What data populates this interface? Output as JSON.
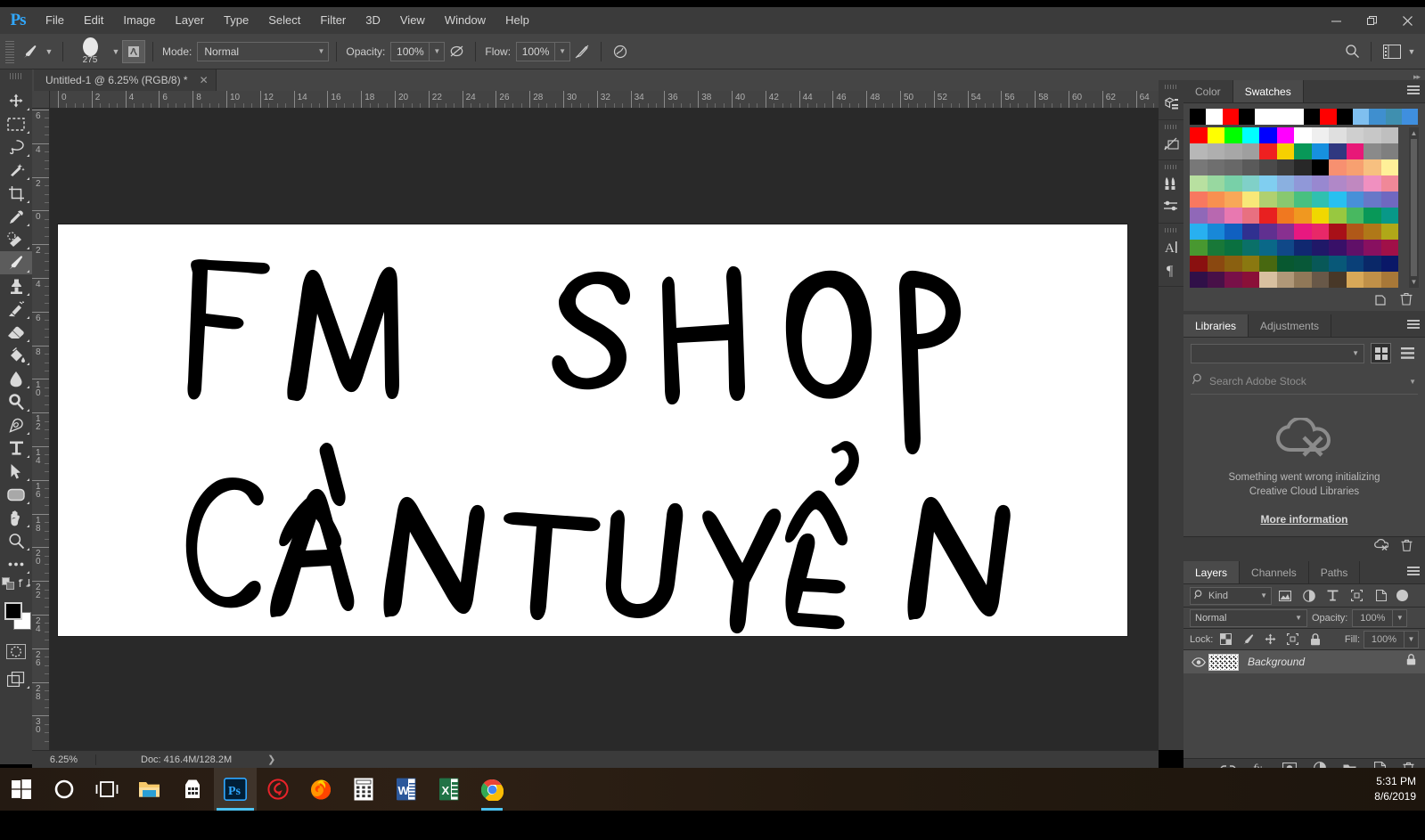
{
  "app": {
    "logo": "Ps",
    "title": "Adobe Photoshop"
  },
  "menubar": {
    "items": [
      "File",
      "Edit",
      "Image",
      "Layer",
      "Type",
      "Select",
      "Filter",
      "3D",
      "View",
      "Window",
      "Help"
    ]
  },
  "window_controls": {
    "minimize": "—",
    "restore": "❐",
    "close": "✕"
  },
  "options_bar": {
    "brush_size": "275",
    "mode_label": "Mode:",
    "mode_value": "Normal",
    "opacity_label": "Opacity:",
    "opacity_value": "100%",
    "flow_label": "Flow:",
    "flow_value": "100%",
    "airbrush_title": "Airbrush",
    "smoothing_title": "Smoothing",
    "tablet_pressure_title": "Tablet pressure"
  },
  "document_tab": {
    "title": "Untitled-1 @ 6.25% (RGB/8) *",
    "close": "✕"
  },
  "toolbar": {
    "tools": [
      {
        "name": "move-tool",
        "title": "Move Tool"
      },
      {
        "name": "marquee-tool",
        "title": "Rectangular Marquee Tool"
      },
      {
        "name": "lasso-tool",
        "title": "Lasso Tool"
      },
      {
        "name": "quick-selection-tool",
        "title": "Quick Selection Tool"
      },
      {
        "name": "crop-tool",
        "title": "Crop Tool"
      },
      {
        "name": "eyedropper-tool",
        "title": "Eyedropper Tool"
      },
      {
        "name": "healing-brush-tool",
        "title": "Spot Healing Brush Tool"
      },
      {
        "name": "brush-tool",
        "title": "Brush Tool",
        "active": true
      },
      {
        "name": "clone-stamp-tool",
        "title": "Clone Stamp Tool"
      },
      {
        "name": "history-brush-tool",
        "title": "History Brush Tool"
      },
      {
        "name": "eraser-tool",
        "title": "Eraser Tool"
      },
      {
        "name": "gradient-tool",
        "title": "Paint Bucket Tool"
      },
      {
        "name": "blur-tool",
        "title": "Blur Tool"
      },
      {
        "name": "dodge-tool",
        "title": "Dodge Tool"
      },
      {
        "name": "pen-tool",
        "title": "Pen Tool"
      },
      {
        "name": "type-tool",
        "title": "Horizontal Type Tool"
      },
      {
        "name": "path-selection-tool",
        "title": "Path Selection Tool"
      },
      {
        "name": "rectangle-tool",
        "title": "Rectangle Tool"
      },
      {
        "name": "hand-tool",
        "title": "Hand Tool"
      },
      {
        "name": "zoom-tool",
        "title": "Zoom Tool"
      },
      {
        "name": "edit-toolbar-tool",
        "title": "Edit Toolbar"
      }
    ],
    "foreground_color": "#000000",
    "background_color": "#ffffff"
  },
  "rulers": {
    "unit": "cm",
    "horizontal_ticks": [
      0,
      2,
      4,
      6,
      8,
      10,
      12,
      14,
      16,
      18,
      20,
      22,
      24,
      26,
      28,
      30,
      32,
      34,
      36,
      38,
      40,
      42,
      44,
      46,
      48,
      50,
      52,
      54,
      56,
      58,
      60,
      62,
      64
    ],
    "vertical_ticks": [
      6,
      4,
      2,
      0,
      2,
      4,
      6,
      8,
      10,
      12,
      14,
      16,
      18,
      20,
      22,
      24,
      26,
      28,
      30
    ]
  },
  "canvas": {
    "line1": "FM SHOP",
    "line2": "CẦN TUYỂN",
    "background": "#ffffff",
    "ink": "#000000"
  },
  "status_bar": {
    "zoom": "6.25%",
    "doc": "Doc: 416.4M/128.2M",
    "arrow": "❯"
  },
  "rail": {
    "icons": [
      {
        "name": "3d-panel-icon"
      },
      {
        "name": "measurement-log-icon"
      },
      {
        "name": "brushes-panel-icon"
      },
      {
        "name": "brush-settings-icon"
      },
      {
        "name": "character-panel-icon"
      },
      {
        "name": "paragraph-panel-icon"
      }
    ]
  },
  "swatches_panel": {
    "tabs": [
      {
        "label": "Color",
        "active": false
      },
      {
        "label": "Swatches",
        "active": true
      }
    ],
    "top_row": [
      "#000000",
      "#ffffff",
      "#ff0000",
      "#000000",
      "#ffffff",
      "#ffffff",
      "#ffffff",
      "#000000",
      "#ff0000",
      "#000000",
      "#7fbfef",
      "#3f8fcf",
      "#3f8faf",
      "#3f8fdf"
    ],
    "grid": [
      [
        "#ff0000",
        "#ffff00",
        "#00ff00",
        "#00ffff",
        "#0000ff",
        "#ff00ff",
        "#ffffff",
        "#efefef",
        "#dfdfdf",
        "#cfcfcf",
        "#c7c7c7",
        "#bfbfbf"
      ],
      [
        "#b7b7b7",
        "#afafaf",
        "#a7a7a7",
        "#9f9f9f",
        "#ef2020",
        "#f5d000",
        "#089858",
        "#1790df",
        "#303880",
        "#e81878",
        "#8a8a8a",
        "#7f7f7f"
      ],
      [
        "#787878",
        "#6f6f6f",
        "#686868",
        "#5a5a5a",
        "#4a4a4a",
        "#3c3c3c",
        "#282828",
        "#000000",
        "#f79070",
        "#f7a070",
        "#f7c080",
        "#fff098"
      ],
      [
        "#b8e0a0",
        "#98d8a0",
        "#78d0a8",
        "#80d0c8",
        "#80cef0",
        "#8ab0e0",
        "#9098d8",
        "#9888d0",
        "#b088c8",
        "#c088c0",
        "#f090c0",
        "#f08898"
      ],
      [
        "#f87860",
        "#f89050",
        "#f8a858",
        "#f8e878",
        "#b0d070",
        "#88c870",
        "#48c080",
        "#30c0b0",
        "#28c0f0",
        "#4890d8",
        "#6878c8",
        "#7068c0"
      ],
      [
        "#9068b8",
        "#b868b0",
        "#e878b0",
        "#e87080",
        "#e82020",
        "#f07820",
        "#f09820",
        "#f0d800",
        "#98c840",
        "#48b860",
        "#089858",
        "#089888"
      ],
      [
        "#28b0f0",
        "#1888d8",
        "#1060c0",
        "#303090",
        "#603090",
        "#883090",
        "#e81880",
        "#e82868",
        "#a81018",
        "#b05818",
        "#b07818",
        "#b0a818"
      ],
      [
        "#489830",
        "#187838",
        "#0a7040",
        "#0a7068",
        "#0a6888",
        "#104888",
        "#102870",
        "#201868",
        "#381068",
        "#601068",
        "#881060",
        "#a01048"
      ],
      [
        "#8a1010",
        "#8a4810",
        "#8a6010",
        "#8a7810",
        "#486810",
        "#085830",
        "#085838",
        "#085858",
        "#085878",
        "#0a4078",
        "#0a2868",
        "#0a1868"
      ],
      [
        "#301048",
        "#481048",
        "#781048",
        "#8a1038",
        "#d8c0a0",
        "#b09878",
        "#907858",
        "#685848",
        "#483828",
        "#d8a858",
        "#c09048",
        "#a87838"
      ]
    ],
    "footer_icons": [
      {
        "name": "new-swatch-icon"
      },
      {
        "name": "delete-swatch-icon"
      }
    ]
  },
  "libraries_panel": {
    "tabs": [
      {
        "label": "Libraries",
        "active": true
      },
      {
        "label": "Adjustments",
        "active": false
      }
    ],
    "library_select_value": "",
    "search_placeholder": "Search Adobe Stock",
    "error_line1": "Something went wrong initializing",
    "error_line2": "Creative Cloud Libraries",
    "more_info_link": "More information",
    "footer_icons": [
      {
        "name": "sync-error-icon"
      },
      {
        "name": "delete-icon"
      }
    ]
  },
  "layers_panel": {
    "tabs": [
      {
        "label": "Layers",
        "active": true
      },
      {
        "label": "Channels",
        "active": false
      },
      {
        "label": "Paths",
        "active": false
      }
    ],
    "filter_kind": "Kind",
    "filter_icons": [
      {
        "name": "filter-pixel-icon"
      },
      {
        "name": "filter-adjustment-icon"
      },
      {
        "name": "filter-type-icon"
      },
      {
        "name": "filter-shape-icon"
      },
      {
        "name": "filter-smartobject-icon"
      }
    ],
    "blend_mode": "Normal",
    "opacity_label": "Opacity:",
    "opacity_value": "100%",
    "lock_label": "Lock:",
    "lock_icons": [
      {
        "name": "lock-transparent-pixels-icon"
      },
      {
        "name": "lock-image-pixels-icon"
      },
      {
        "name": "lock-position-icon"
      },
      {
        "name": "lock-artboard-icon"
      },
      {
        "name": "lock-all-icon"
      }
    ],
    "fill_label": "Fill:",
    "fill_value": "100%",
    "layers": [
      {
        "name": "Background",
        "visible": true,
        "locked": true
      }
    ],
    "footer_icons": [
      {
        "name": "link-layers-icon"
      },
      {
        "name": "layer-style-icon"
      },
      {
        "name": "layer-mask-icon"
      },
      {
        "name": "adjustment-layer-icon"
      },
      {
        "name": "new-group-icon"
      },
      {
        "name": "new-layer-icon"
      },
      {
        "name": "delete-layer-icon"
      }
    ]
  },
  "taskbar": {
    "items": [
      {
        "name": "start-button",
        "label": "Start"
      },
      {
        "name": "cortana-button",
        "label": "Cortana"
      },
      {
        "name": "task-view-button",
        "label": "Task View"
      },
      {
        "name": "file-explorer-button",
        "label": "File Explorer"
      },
      {
        "name": "microsoft-store-button",
        "label": "Microsoft Store"
      },
      {
        "name": "photoshop-button",
        "label": "Adobe Photoshop",
        "active": true
      },
      {
        "name": "coccoc-button",
        "label": "Cốc Cốc"
      },
      {
        "name": "firefox-button",
        "label": "Mozilla Firefox"
      },
      {
        "name": "calculator-button",
        "label": "Calculator"
      },
      {
        "name": "word-button",
        "label": "Microsoft Word"
      },
      {
        "name": "excel-button",
        "label": "Microsoft Excel"
      },
      {
        "name": "chrome-button",
        "label": "Google Chrome",
        "running": true
      }
    ],
    "clock_time": "5:31 PM",
    "clock_date": "8/6/2019"
  }
}
